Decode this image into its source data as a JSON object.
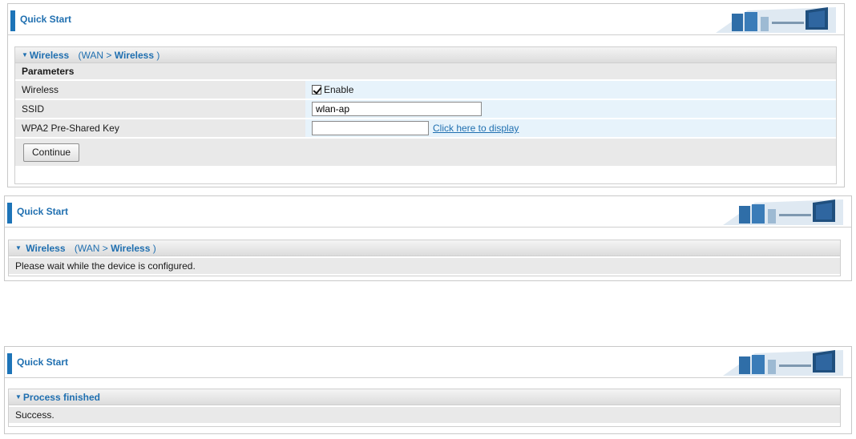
{
  "panel1": {
    "header": {
      "title": "Quick Start"
    },
    "section": {
      "title": "Wireless",
      "crumb_open": "(WAN >",
      "crumb_page": "Wireless",
      "crumb_close": ")",
      "params_label": "Parameters",
      "rows": [
        {
          "label": "Wireless",
          "checkbox_label": "Enable",
          "checked": true
        },
        {
          "label": "SSID",
          "value": "wlan-ap"
        },
        {
          "label": "WPA2 Pre-Shared Key",
          "value": "",
          "link": "Click here to display"
        }
      ],
      "continue_label": "Continue"
    }
  },
  "panel2": {
    "header": {
      "title": "Quick Start"
    },
    "section": {
      "title": "Wireless",
      "crumb_open": "(WAN >",
      "crumb_page": "Wireless",
      "crumb_close": ")",
      "message": "Please wait while the device is configured."
    }
  },
  "panel3": {
    "header": {
      "title": "Quick Start"
    },
    "section": {
      "title": "Process finished",
      "message": "Success."
    }
  },
  "colors": {
    "accent": "#1f6fb0",
    "header_bar": "#1d74b8",
    "label_bg": "#e9e9e9",
    "value_bg": "#e7f3fb"
  },
  "icons": {
    "header_graphic": "office-chairs-banner-icon",
    "section_caret": "caret-down-icon"
  }
}
